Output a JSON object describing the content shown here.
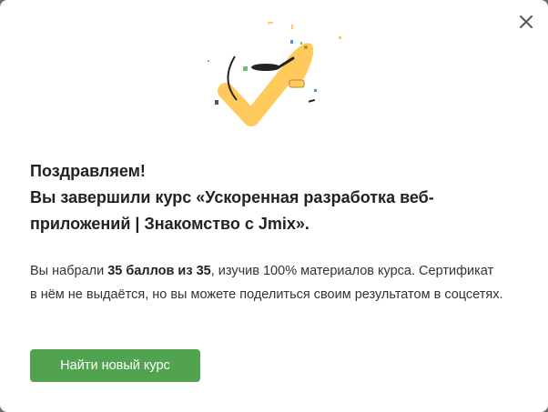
{
  "modal": {
    "close_icon": "close-icon",
    "illustration_icon": "checkmark-celebration-icon",
    "title_line1": "Поздравляем!",
    "title_line2": "Вы завершили курс «Ускоренная разработка веб-приложений | Знакомство с Jmix».",
    "body": {
      "prefix": "Вы набрали ",
      "score": "35 баллов из 35",
      "suffix": ", изучив 100% материалов курса. Сертификат в нём не выдаётся, но вы можете поделиться своим результатом в соцсетях."
    },
    "cta_label": "Найти новый курс"
  },
  "colors": {
    "accent": "#52a350",
    "check": "#ffc95c",
    "text": "#222222"
  }
}
